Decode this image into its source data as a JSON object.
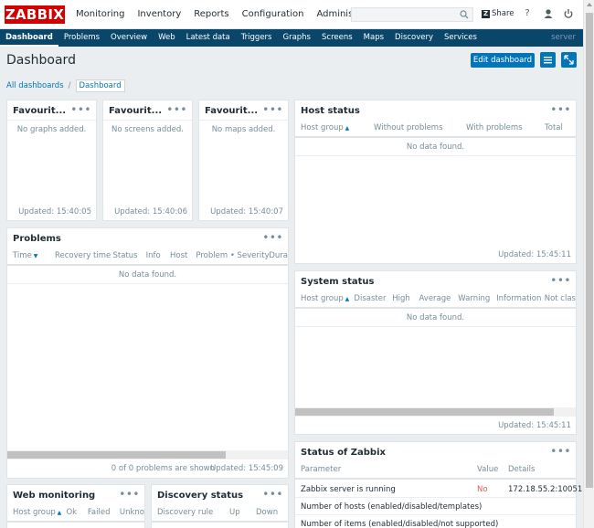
{
  "app": {
    "logo": "ZABBIX",
    "top_menu": [
      "Monitoring",
      "Inventory",
      "Reports",
      "Configuration",
      "Administration"
    ],
    "share_label": "Share",
    "search_placeholder": ""
  },
  "subnav": {
    "items": [
      "Dashboard",
      "Problems",
      "Overview",
      "Web",
      "Latest data",
      "Triggers",
      "Graphs",
      "Screens",
      "Maps",
      "Discovery",
      "Services"
    ],
    "server": "server"
  },
  "page": {
    "title": "Dashboard",
    "edit_button": "Edit dashboard",
    "breadcrumb": [
      "All dashboards",
      "Dashboard"
    ]
  },
  "widgets": {
    "fav_graphs": {
      "title": "Favourit...",
      "empty": "No graphs added.",
      "updated": "Updated: 15:40:05"
    },
    "fav_screens": {
      "title": "Favourit...",
      "empty": "No screens added.",
      "updated": "Updated: 15:40:06"
    },
    "fav_maps": {
      "title": "Favourit...",
      "empty": "No maps added.",
      "updated": "Updated: 15:40:07"
    },
    "host_status": {
      "title": "Host status",
      "columns": [
        "Host group",
        "Without problems",
        "With problems",
        "Total"
      ],
      "empty": "No data found.",
      "updated": "Updated: 15:45:11"
    },
    "problems": {
      "title": "Problems",
      "columns": [
        "Time",
        "Recovery time",
        "Status",
        "Info",
        "Host",
        "Problem • Severity",
        "Dura"
      ],
      "empty": "No data found.",
      "footer_count": "0 of 0 problems are shown",
      "updated": "Updated: 15:45:09"
    },
    "system_status": {
      "title": "System status",
      "columns": [
        "Host group",
        "Disaster",
        "High",
        "Average",
        "Warning",
        "Information",
        "Not clas"
      ],
      "empty": "No data found.",
      "updated": "Updated: 15:45:11"
    },
    "status_of_zabbix": {
      "title": "Status of Zabbix",
      "columns": [
        "Parameter",
        "Value",
        "Details"
      ],
      "rows": [
        {
          "parameter": "Zabbix server is running",
          "value": "No",
          "details": "172.18.55.2:10051"
        },
        {
          "parameter": "Number of hosts (enabled/disabled/templates)",
          "value": "",
          "details": ""
        },
        {
          "parameter": "Number of items (enabled/disabled/not supported)",
          "value": "",
          "details": ""
        }
      ]
    },
    "web_monitoring": {
      "title": "Web monitoring",
      "columns": [
        "Host group",
        "Ok",
        "Failed",
        "Unkno"
      ]
    },
    "discovery_status": {
      "title": "Discovery status",
      "columns": [
        "Discovery rule",
        "Up",
        "Down"
      ]
    }
  },
  "colors": {
    "brand_red": "#d40000",
    "nav_blue": "#0a466a",
    "button_blue": "#0275b8",
    "error_red": "#e45959"
  },
  "icons": [
    "search-icon",
    "share-icon",
    "help-icon",
    "user-icon",
    "power-icon",
    "menu-icon",
    "fullscreen-icon",
    "more-dots-icon"
  ]
}
